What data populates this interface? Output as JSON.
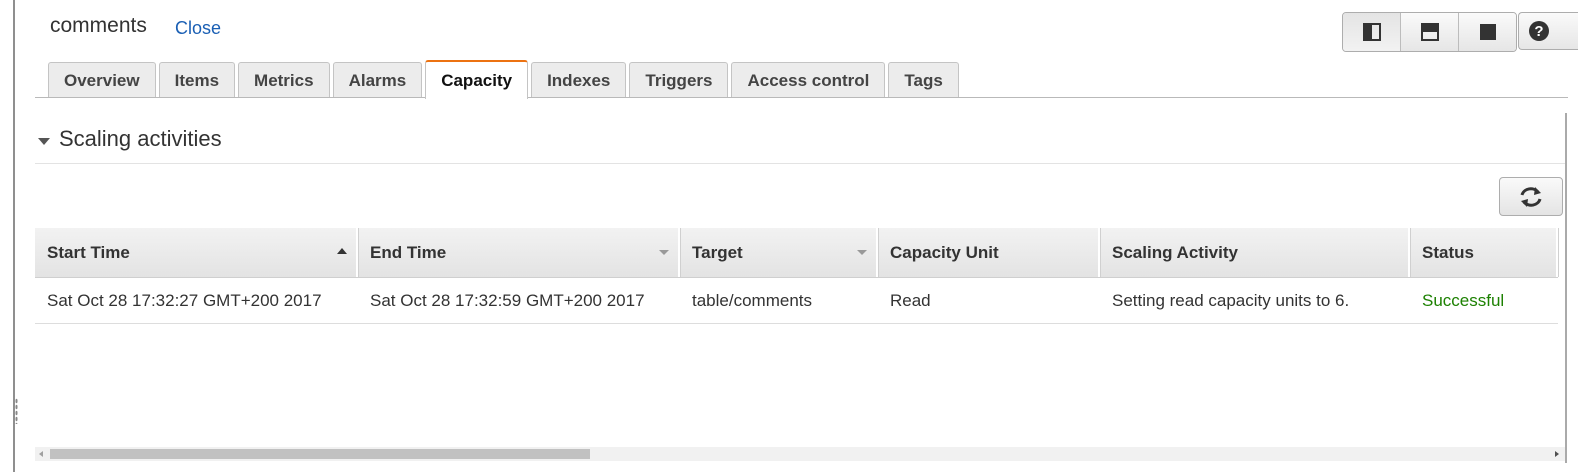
{
  "panel": {
    "title": "comments",
    "close_label": "Close"
  },
  "layout_buttons": [
    {
      "name": "split-vertical",
      "icon": "split-vertical-icon"
    },
    {
      "name": "split-horizontal",
      "icon": "split-horizontal-icon"
    },
    {
      "name": "full-panel",
      "icon": "full-panel-icon"
    }
  ],
  "help_icon": "help-icon",
  "tabs": [
    {
      "label": "Overview"
    },
    {
      "label": "Items"
    },
    {
      "label": "Metrics"
    },
    {
      "label": "Alarms"
    },
    {
      "label": "Capacity",
      "active": true
    },
    {
      "label": "Indexes"
    },
    {
      "label": "Triggers"
    },
    {
      "label": "Access control"
    },
    {
      "label": "Tags"
    }
  ],
  "section": {
    "title": "Scaling activities",
    "expanded": true
  },
  "table": {
    "columns": [
      "Start Time",
      "End Time",
      "Target",
      "Capacity Unit",
      "Scaling Activity",
      "Status"
    ],
    "sorted_column": "Start Time",
    "sort_direction": "ascending",
    "rows": [
      {
        "start_time": "Sat Oct 28 17:32:27 GMT+200 2017",
        "end_time": "Sat Oct 28 17:32:59 GMT+200 2017",
        "target": "table/comments",
        "capacity_unit": "Read",
        "scaling_activity": "Setting read capacity units to 6.",
        "status": "Successful"
      }
    ]
  },
  "colors": {
    "accent_tab": "#ec7211",
    "link": "#1a5fb4",
    "success": "#1d8102"
  }
}
